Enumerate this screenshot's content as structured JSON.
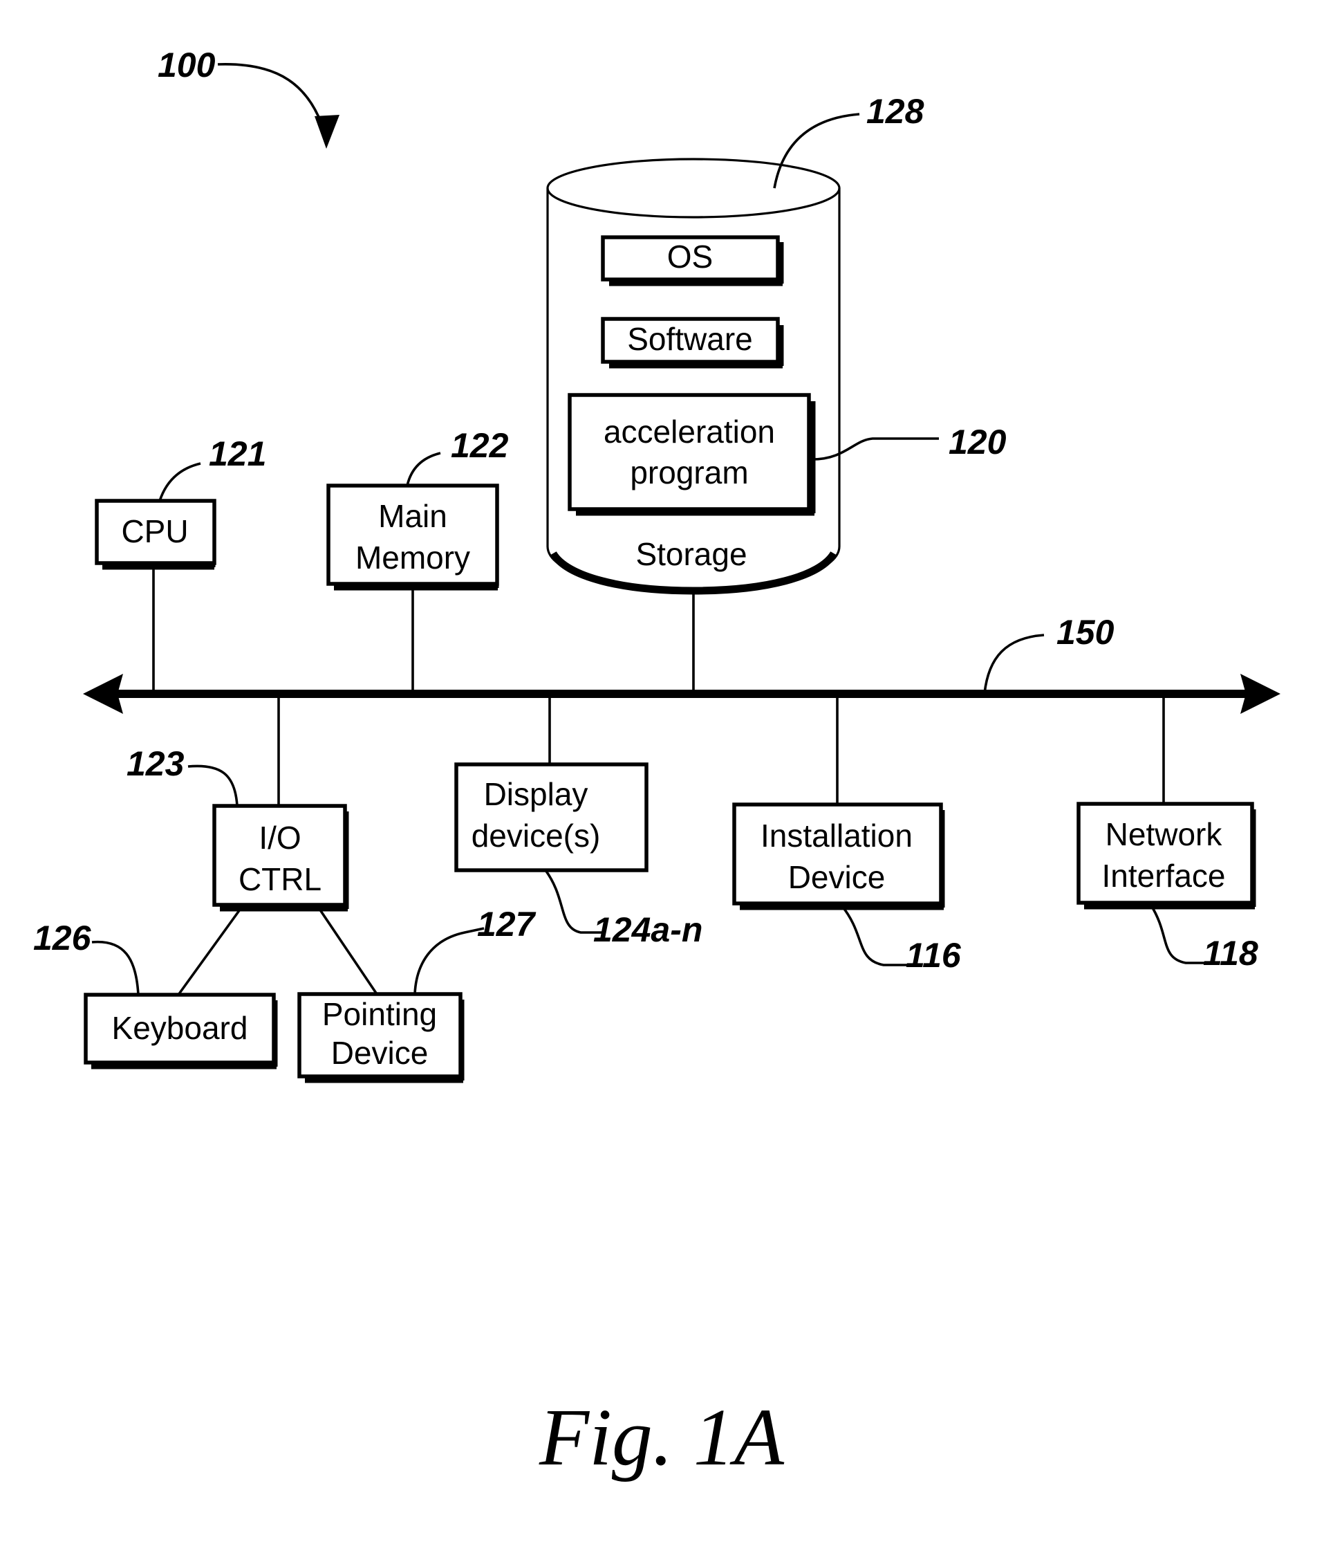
{
  "figure": {
    "caption": "Fig. 1A",
    "system_ref": "100"
  },
  "nodes": {
    "cpu": {
      "label": "CPU",
      "ref": "121"
    },
    "main_memory": {
      "label_line1": "Main",
      "label_line2": "Memory",
      "ref": "122"
    },
    "storage": {
      "label": "Storage",
      "ref": "128",
      "contents": [
        {
          "label": "OS"
        },
        {
          "label": "Software"
        },
        {
          "label_line1": "acceleration",
          "label_line2": "program",
          "ref": "120"
        }
      ]
    },
    "io_ctrl": {
      "label_line1": "I/O",
      "label_line2": "CTRL",
      "ref": "123"
    },
    "display": {
      "label_line1": "Display",
      "label_line2": "device(s)",
      "ref": "124a-n"
    },
    "installation": {
      "label_line1": "Installation",
      "label_line2": "Device",
      "ref": "116"
    },
    "network": {
      "label_line1": "Network",
      "label_line2": "Interface",
      "ref": "118"
    },
    "keyboard": {
      "label": "Keyboard",
      "ref": "126"
    },
    "pointing": {
      "label_line1": "Pointing",
      "label_line2": "Device",
      "ref": "127"
    },
    "bus": {
      "ref": "150"
    }
  },
  "colors": {
    "ink": "#000000",
    "paper": "#ffffff"
  }
}
